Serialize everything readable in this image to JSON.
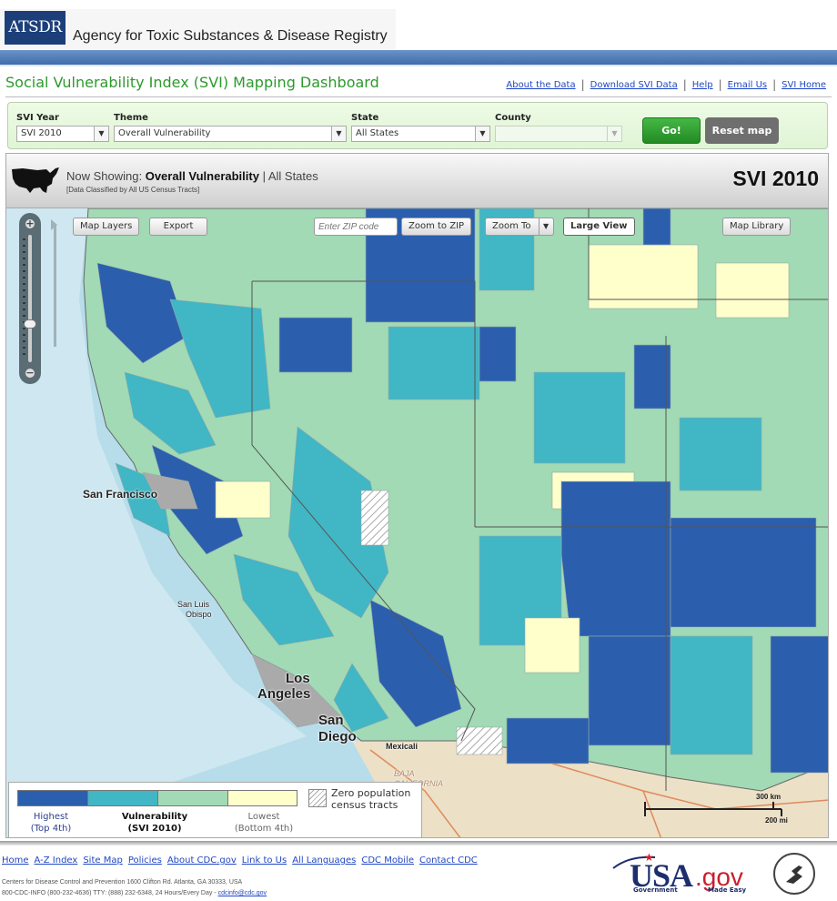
{
  "header": {
    "logo_text": "ATSDR",
    "agency_name": "Agency for Toxic Substances & Disease Registry",
    "page_title": "Social Vulnerability Index (SVI) Mapping Dashboard",
    "links": [
      "About the Data",
      "Download SVI Data",
      "Help",
      "Email Us",
      "SVI Home"
    ]
  },
  "controls": {
    "svi_year": {
      "label": "SVI Year",
      "value": "SVI 2010"
    },
    "theme": {
      "label": "Theme",
      "value": "Overall Vulnerability"
    },
    "state": {
      "label": "State",
      "value": "All States"
    },
    "county": {
      "label": "County",
      "value": ""
    },
    "go_label": "Go!",
    "reset_label": "Reset map"
  },
  "showing": {
    "prefix": "Now Showing: ",
    "theme": "Overall Vulnerability",
    "separator": " | ",
    "region": "All States",
    "subtitle": "[Data Classified by All US Census Tracts]",
    "year_badge": "SVI 2010"
  },
  "map": {
    "buttons": {
      "map_layers": "Map Layers",
      "export": "Export",
      "zip_placeholder": "Enter ZIP code",
      "zoom_to_zip": "Zoom to ZIP",
      "zoom_to": "Zoom To",
      "large_view": "Large View",
      "map_library": "Map Library"
    },
    "cities": {
      "sf": "San Francisco",
      "slo1": "San Luis",
      "slo2": "Obispo",
      "la1": "Los",
      "la2": "Angeles",
      "sd1": "San",
      "sd2": "Diego",
      "mexicali": "Mexicali",
      "baja": "BAJA CALIFORNIA"
    },
    "colors": {
      "highest": "#2b5fae",
      "second": "#41b6c4",
      "third": "#a1dab4",
      "lowest": "#ffffcc",
      "ocean": "#b7dcea",
      "mexico": "#ece0c7"
    },
    "scale": {
      "km": "300 km",
      "mi": "200 mi"
    }
  },
  "legend": {
    "highest": [
      "Highest",
      "(Top 4th)"
    ],
    "middle": [
      "Vulnerability",
      "(SVI 2010)"
    ],
    "lowest": [
      "Lowest",
      "(Bottom 4th)"
    ],
    "zero": [
      "Zero population",
      "census tracts"
    ]
  },
  "footer": {
    "links": [
      "Home",
      "A-Z Index",
      "Site Map",
      "Policies",
      "About CDC.gov",
      "Link to Us",
      "All Languages",
      "CDC Mobile",
      "Contact CDC"
    ],
    "address": "Centers for Disease Control and Prevention  1600 Clifton Rd. Atlanta, GA 30333, USA",
    "phone": "800-CDC-INFO (800-232-4636) TTY: (888) 232-6348, 24 Hours/Every Day - ",
    "email": "cdcinfo@cdc.gov",
    "usagov": {
      "main": "USA",
      "gov": ".gov",
      "tagline1": "Government",
      "tagline2": "Made Easy"
    }
  }
}
